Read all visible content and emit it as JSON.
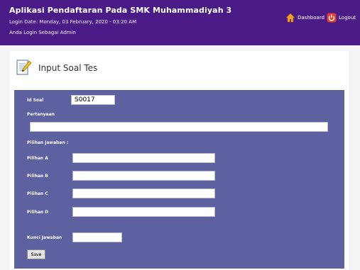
{
  "header": {
    "app_title": "Aplikasi Pendaftaran Pada SMK Muhammadiyah 3",
    "login_date": "Login Date: Monday, 03 February, 2020 - 03:20 AM",
    "login_as": "Anda Login Sebagai Admin",
    "nav": {
      "dashboard_label": "Dashboard",
      "logout_label": "Logout",
      "dashboard_icon": "house-icon",
      "logout_icon": "power-icon"
    }
  },
  "page": {
    "title": "Input Soal Tes",
    "title_icon": "edit-document-icon"
  },
  "form": {
    "id_soal_label": "Id Soal",
    "id_soal_value": "S0017",
    "pertanyaan_label": "Pertanyaan",
    "pertanyaan_value": "",
    "pilihan_heading": "Pilihan Jawaban :",
    "options": [
      {
        "label": "Pilihan A",
        "value": ""
      },
      {
        "label": "Pilihan B",
        "value": ""
      },
      {
        "label": "Pilihan C",
        "value": ""
      },
      {
        "label": "Pilihan D",
        "value": ""
      }
    ],
    "kunci_label": "Kunci Jawaban",
    "kunci_value": "",
    "save_label": "Save"
  },
  "colors": {
    "header_bg": "#4a1b86",
    "form_panel_bg": "#5d61a0"
  }
}
